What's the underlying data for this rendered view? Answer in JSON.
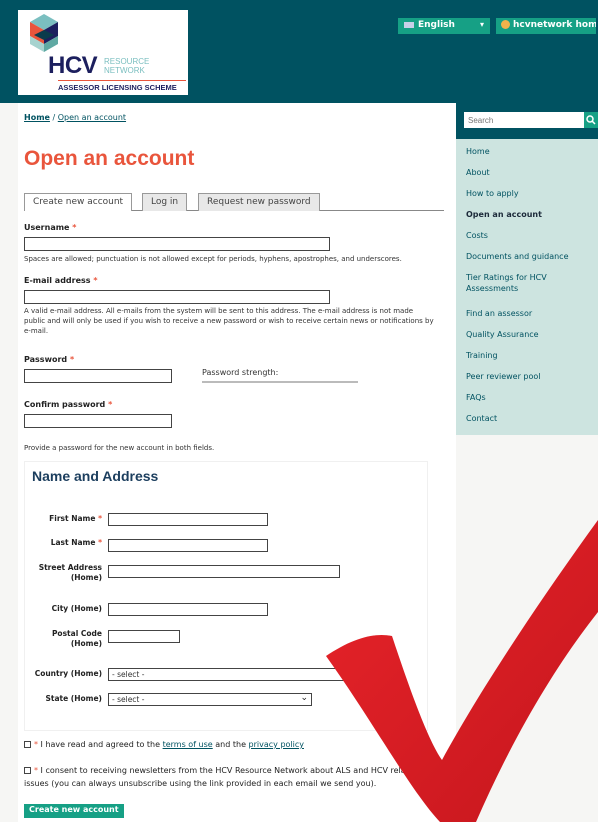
{
  "header": {
    "logo": {
      "hcv": "HCV",
      "resource": "RESOURCE",
      "network": "NETWORK",
      "scheme": "ASSESSOR LICENSING SCHEME"
    },
    "language_button": "English",
    "home_button": "hcvnetwork home"
  },
  "breadcrumb": {
    "home": "Home",
    "separator": "/",
    "current": "Open an account"
  },
  "page_title": "Open an account",
  "tabs": [
    {
      "label": "Create new account",
      "active": true
    },
    {
      "label": "Log in",
      "active": false
    },
    {
      "label": "Request new password",
      "active": false
    }
  ],
  "form": {
    "required_mark": "*",
    "username": {
      "label": "Username",
      "value": "",
      "description": "Spaces are allowed; punctuation is not allowed except for periods, hyphens, apostrophes, and underscores."
    },
    "email": {
      "label": "E-mail address",
      "value": "",
      "description_1": "A valid e-mail address. All e-mails from the system will be sent to this address. The e-mail address is not made",
      "description_2": "public and will only be used if you wish to receive a new password or wish to receive certain news or notifications by",
      "description_3": "e-mail."
    },
    "password": {
      "label": "Password",
      "strength_label": "Password strength:"
    },
    "confirm_password": {
      "label": "Confirm password",
      "description": "Provide a password for the new account in both fields."
    }
  },
  "name_address": {
    "title": "Name and Address",
    "first_name": "First Name",
    "last_name": "Last Name",
    "street_1": "Street Address",
    "street_2": "(Home)",
    "city": "City (Home)",
    "postal_1": "Postal Code",
    "postal_2": "(Home)",
    "country": "Country (Home)",
    "country_value": "- select -",
    "state": "State (Home)",
    "state_value": "- select -"
  },
  "agreements": {
    "terms_prefix": "I have read and agreed to the",
    "terms_link": "terms of use",
    "and": "and the",
    "privacy_link": "privacy policy",
    "newsletter_1": "I consent to receiving newsletters from the HCV Resource Network about ALS and HCV rela",
    "newsletter_2": "issues (you can always unsubscribe using the link provided in each email we send you)."
  },
  "submit_button": "Create new account",
  "sidebar": {
    "search_placeholder": "Search",
    "nav": [
      {
        "label": "Home",
        "active": false
      },
      {
        "label": "About",
        "active": false
      },
      {
        "label": "How to apply",
        "active": false
      },
      {
        "label": "Open an account",
        "active": true
      },
      {
        "label": "Costs",
        "active": false
      },
      {
        "label": "Documents and guidance",
        "active": false
      },
      {
        "label": "Tier Ratings for HCV Assessments",
        "active": false
      },
      {
        "label": "Find an assessor",
        "active": false
      },
      {
        "label": "Quality Assurance",
        "active": false
      },
      {
        "label": "Training",
        "active": false
      },
      {
        "label": "Peer reviewer pool",
        "active": false
      },
      {
        "label": "FAQs",
        "active": false
      },
      {
        "label": "Contact",
        "active": false
      }
    ]
  },
  "colors": {
    "header_bg": "#005261",
    "accent_green": "#16a085",
    "title_orange": "#e9553c",
    "sidebar_bg": "#cde4e0",
    "checkmark_red": "#e41e26"
  },
  "icons": [
    "flag-icon",
    "caret-down-icon",
    "globe-icon",
    "search-icon",
    "chevron-down-icon",
    "red-checkmark-overlay"
  ]
}
